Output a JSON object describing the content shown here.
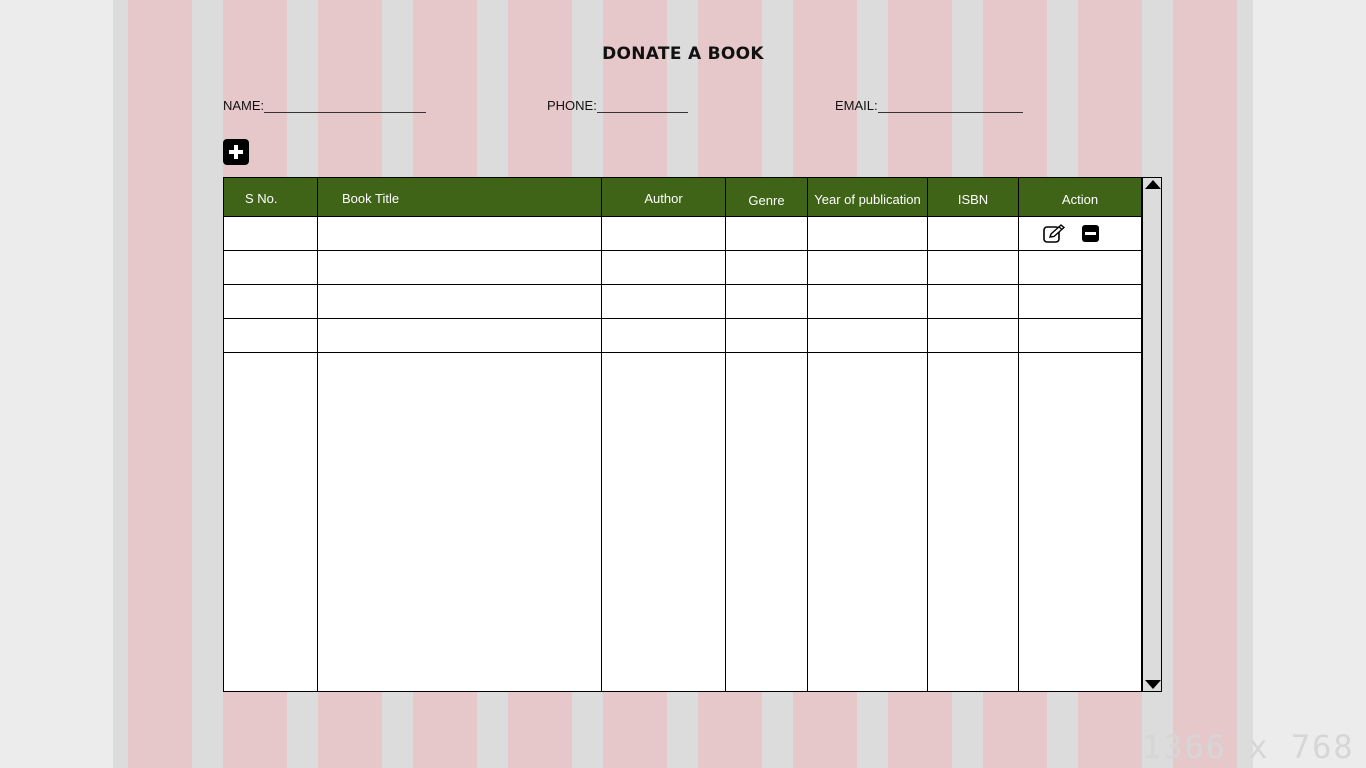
{
  "form": {
    "title": "DONATE A BOOK",
    "name_label": "NAME:",
    "phone_label": "PHONE:",
    "email_label": "EMAIL:"
  },
  "table": {
    "columns": [
      "S No.",
      "Book Title",
      "Author",
      "Genre",
      "Year of publication",
      "ISBN",
      "Action"
    ],
    "row_count": 4
  },
  "icons": {
    "add": "plus-icon",
    "edit": "edit-icon",
    "remove": "minus-icon",
    "scroll_up": "arrow-up-icon",
    "scroll_down": "arrow-down-icon"
  },
  "colors": {
    "header_green": "#3f6418",
    "stripe_pink": "#e6c8ca",
    "background_gray": "#dcdcdc"
  },
  "watermark": "1366 x 768"
}
